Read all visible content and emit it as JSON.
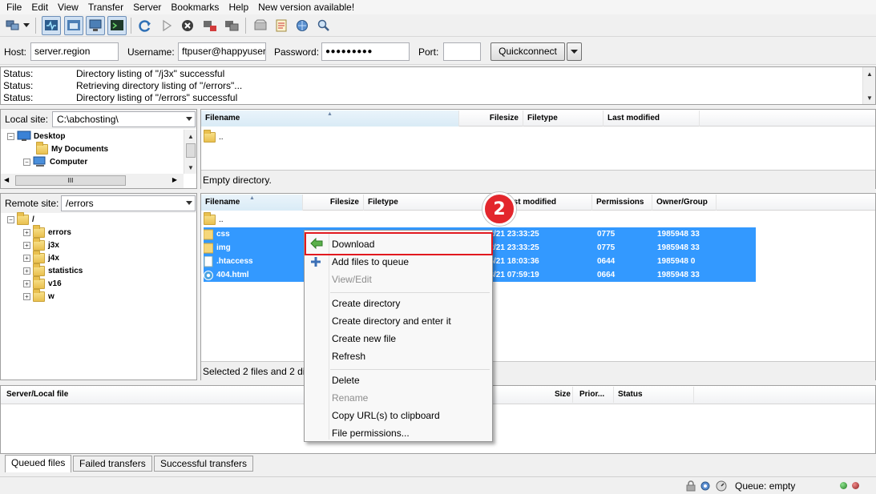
{
  "menu": [
    "File",
    "Edit",
    "View",
    "Transfer",
    "Server",
    "Bookmarks",
    "Help",
    "New version available!"
  ],
  "toolbar_icons": [
    "site-manager-icon",
    "dropdown-arrow-icon",
    "toggle-message-log-icon",
    "toggle-local-tree-icon",
    "toggle-remote-tree-icon",
    "toggle-queue-icon",
    "refresh-icon",
    "process-queue-icon",
    "cancel-icon",
    "disconnect-icon",
    "reconnect-icon",
    "filter-icon",
    "compare-icon",
    "sync-browse-icon",
    "search-icon"
  ],
  "quickconnect": {
    "host_label": "Host:",
    "host_value": "server.region",
    "username_label": "Username:",
    "username_value": "ftpuser@happyuser",
    "password_label": "Password:",
    "password_value": "●●●●●●●●●",
    "port_label": "Port:",
    "port_value": "",
    "button_label": "Quickconnect"
  },
  "log": [
    {
      "key": "Status:",
      "msg": "Directory listing of \"/j3x\" successful"
    },
    {
      "key": "Status:",
      "msg": "Retrieving directory listing of \"/errors\"..."
    },
    {
      "key": "Status:",
      "msg": "Directory listing of \"/errors\" successful"
    }
  ],
  "local": {
    "site_label": "Local site:",
    "site_path": "C:\\abchosting\\",
    "tree": [
      "Desktop",
      "My Documents",
      "Computer"
    ],
    "columns": [
      "Filename",
      "Filesize",
      "Filetype",
      "Last modified"
    ],
    "files": [
      ".."
    ],
    "status": "Empty directory."
  },
  "remote": {
    "site_label": "Remote site:",
    "site_path": "/errors",
    "tree_root": "/",
    "tree": [
      "errors",
      "j3x",
      "j4x",
      "statistics",
      "v16",
      "w"
    ],
    "columns": [
      "Filename",
      "Filesize",
      "Filetype",
      "Last modified",
      "Permissions",
      "Owner/Group"
    ],
    "files": [
      {
        "name": "..",
        "date": "",
        "perm": "",
        "owner": ""
      },
      {
        "name": "css",
        "date": "09/12/21 23:33:25",
        "perm": "0775",
        "owner": "1985948 33"
      },
      {
        "name": "img",
        "date": "09/12/21 23:33:25",
        "perm": "0775",
        "owner": "1985948 33"
      },
      {
        "name": ".htaccess",
        "date": "10/06/21 18:03:36",
        "perm": "0644",
        "owner": "1985948 0"
      },
      {
        "name": "404.html",
        "date": "09/13/21 07:59:19",
        "perm": "0664",
        "owner": "1985948 33"
      }
    ],
    "status": "Selected 2 files and 2 directories."
  },
  "queue": {
    "columns": [
      "Server/Local file",
      "Size",
      "Prior...",
      "Status"
    ],
    "tabs": [
      "Queued files",
      "Failed transfers",
      "Successful transfers"
    ]
  },
  "statusbar": {
    "queue": "Queue: empty"
  },
  "context_menu": {
    "items": [
      {
        "label": "Download",
        "disabled": false
      },
      {
        "label": "Add files to queue",
        "disabled": false
      },
      {
        "label": "View/Edit",
        "disabled": true
      },
      {
        "label": "Create directory",
        "disabled": false
      },
      {
        "label": "Create directory and enter it",
        "disabled": false
      },
      {
        "label": "Create new file",
        "disabled": false
      },
      {
        "label": "Refresh",
        "disabled": false
      },
      {
        "label": "Delete",
        "disabled": false
      },
      {
        "label": "Rename",
        "disabled": true
      },
      {
        "label": "Copy URL(s) to clipboard",
        "disabled": false
      },
      {
        "label": "File permissions...",
        "disabled": false
      }
    ]
  },
  "callout": {
    "number": "2"
  },
  "colors": {
    "selection": "#3399ff",
    "callout": "#e3262c",
    "highlight_border": "#e2191f"
  }
}
